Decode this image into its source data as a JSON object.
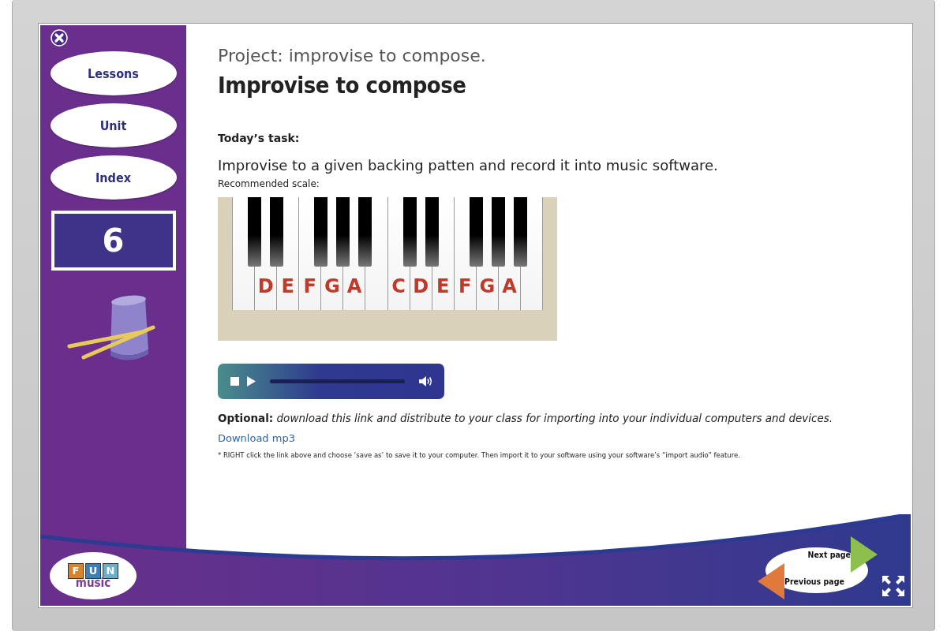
{
  "sidebar": {
    "buttons": [
      {
        "label": "Lessons"
      },
      {
        "label": "Unit"
      },
      {
        "label": "Index"
      }
    ],
    "page_number": "6"
  },
  "content": {
    "heading": "Project: improvise to compose.",
    "title": "Improvise to compose",
    "task_label": "Today’s task:",
    "task": "Improvise to a given backing patten and record it into music software.",
    "scale_label": "Recommended scale:",
    "piano": {
      "label_groups": [
        [
          "D",
          "E",
          "F",
          "G",
          "A"
        ],
        [
          "C",
          "D",
          "E",
          "F",
          "G",
          "A"
        ]
      ]
    },
    "optional": "**Optional:** *download this link and distribute to your class for importing into your individual computers and devices.*",
    "download_link": "Download mp3",
    "footnote": "* RIGHT click the link above and choose ‘save as’ to save it to your computer. Then import it to your software using your software’s “import audio” feature."
  },
  "footer": {
    "logo": {
      "letters": [
        "F",
        "U",
        "N"
      ],
      "word": "music"
    },
    "next": "Next page",
    "previous": "Previous page"
  }
}
